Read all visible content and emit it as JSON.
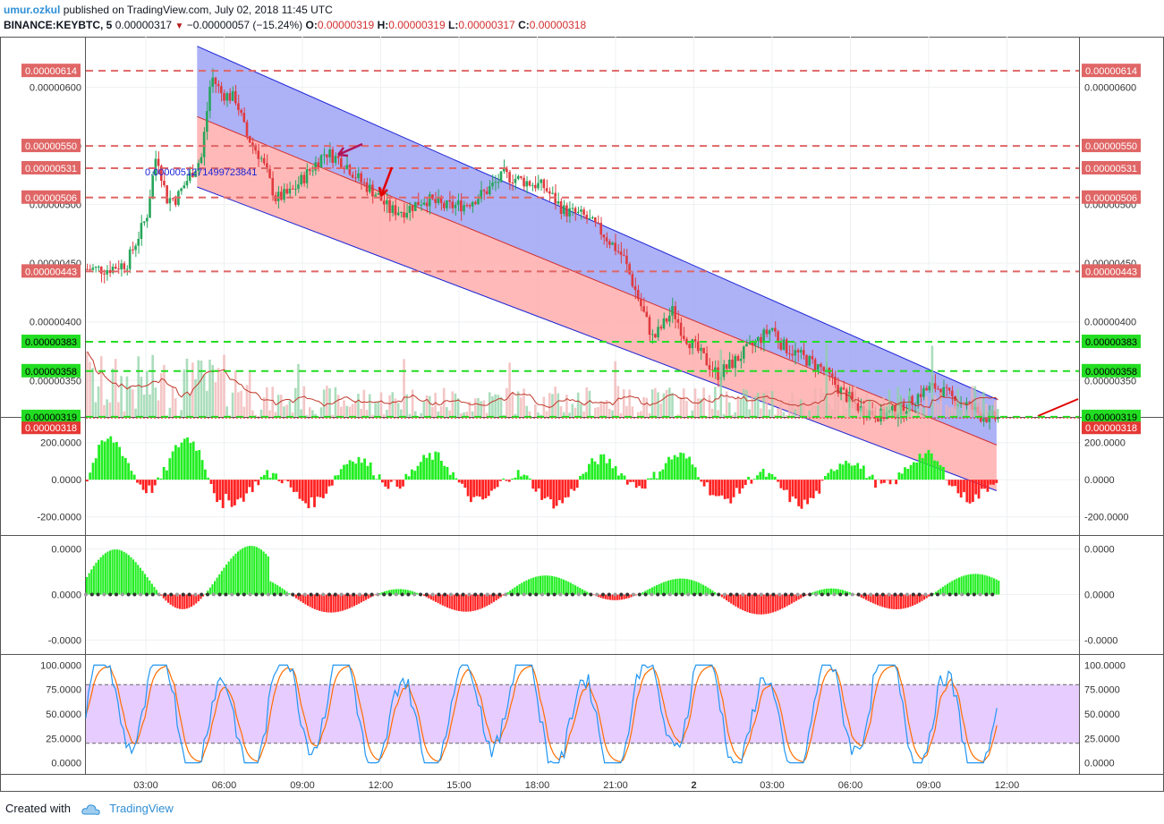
{
  "header": {
    "author": "umur.ozkul",
    "published": "published on TradingView.com, July 02, 2018 11:45 UTC",
    "symbol": "BINANCE:KEYBTC, 5",
    "last": "0.00000317",
    "change": "−0.00000057 (−15.24%)",
    "o_label": "O:",
    "o": "0.00000319",
    "h_label": "H:",
    "h": "0.00000319",
    "l_label": "L:",
    "l": "0.00000317",
    "c_label": "C:",
    "c": "0.00000318"
  },
  "footer": {
    "created_with": "Created with",
    "brand": "TradingView"
  },
  "colors": {
    "up": "#26a65b",
    "down": "#e03a3e",
    "red_level": "#e06666",
    "green_level": "#22dd22",
    "channel_upper": "#9fa3f5",
    "channel_lower": "#ffadad",
    "osc_up": "#22ee22",
    "osc_down": "#ff2222",
    "stoch_k": "#2196f3",
    "stoch_d": "#ff6d00",
    "stoch_band": "#e6ccff"
  },
  "chart_data": [
    {
      "type": "candlestick",
      "title": "",
      "x_ticks": [
        "03:00",
        "06:00",
        "09:00",
        "12:00",
        "15:00",
        "18:00",
        "21:00",
        "2",
        "03:00",
        "06:00",
        "09:00",
        "12:00"
      ],
      "y_ticks": [
        "0.00000600",
        "0.00000550",
        "0.00000500",
        "0.00000450",
        "0.00000400",
        "0.00000350"
      ],
      "ylim": [
        3.075e-06,
        6.355e-06
      ],
      "price_levels": [
        {
          "label": "0.00000614",
          "value": 6.14e-06,
          "color": "red"
        },
        {
          "label": "0.00000550",
          "value": 5.5e-06,
          "color": "red"
        },
        {
          "label": "0.00000531",
          "value": 5.31e-06,
          "color": "red"
        },
        {
          "label": "0.00000506",
          "value": 5.06e-06,
          "color": "red"
        },
        {
          "label": "0.00000443",
          "value": 4.43e-06,
          "color": "red"
        },
        {
          "label": "0.00000383",
          "value": 3.83e-06,
          "color": "green"
        },
        {
          "label": "0.00000358",
          "value": 3.58e-06,
          "color": "green"
        },
        {
          "label": "0.00000319",
          "value": 3.19e-06,
          "color": "green"
        }
      ],
      "last_price_label": "0.00000318",
      "annotation_text": "0.0000051271499723841",
      "close_path": [
        [
          0,
          4.45
        ],
        [
          0.02,
          4.45
        ],
        [
          0.04,
          4.5
        ],
        [
          0.06,
          4.9
        ],
        [
          0.07,
          5.45
        ],
        [
          0.08,
          5.05
        ],
        [
          0.09,
          5.05
        ],
        [
          0.1,
          5.2
        ],
        [
          0.115,
          5.4
        ],
        [
          0.125,
          6.1
        ],
        [
          0.135,
          5.95
        ],
        [
          0.15,
          5.9
        ],
        [
          0.16,
          5.6
        ],
        [
          0.175,
          5.4
        ],
        [
          0.19,
          5.05
        ],
        [
          0.205,
          5.1
        ],
        [
          0.22,
          5.25
        ],
        [
          0.24,
          5.45
        ],
        [
          0.26,
          5.35
        ],
        [
          0.275,
          5.2
        ],
        [
          0.29,
          5.1
        ],
        [
          0.305,
          4.95
        ],
        [
          0.32,
          4.95
        ],
        [
          0.34,
          5.05
        ],
        [
          0.36,
          4.98
        ],
        [
          0.38,
          5.0
        ],
        [
          0.4,
          5.1
        ],
        [
          0.42,
          5.25
        ],
        [
          0.44,
          5.2
        ],
        [
          0.46,
          5.15
        ],
        [
          0.48,
          4.95
        ],
        [
          0.5,
          4.9
        ],
        [
          0.52,
          4.75
        ],
        [
          0.54,
          4.55
        ],
        [
          0.555,
          4.2
        ],
        [
          0.57,
          3.85
        ],
        [
          0.59,
          4.1
        ],
        [
          0.6,
          3.9
        ],
        [
          0.62,
          3.7
        ],
        [
          0.635,
          3.55
        ],
        [
          0.65,
          3.65
        ],
        [
          0.67,
          3.8
        ],
        [
          0.69,
          3.95
        ],
        [
          0.7,
          3.8
        ],
        [
          0.72,
          3.7
        ],
        [
          0.74,
          3.6
        ],
        [
          0.76,
          3.4
        ],
        [
          0.78,
          3.25
        ],
        [
          0.8,
          3.2
        ],
        [
          0.82,
          3.25
        ],
        [
          0.84,
          3.4
        ],
        [
          0.855,
          3.45
        ],
        [
          0.87,
          3.35
        ],
        [
          0.885,
          3.3
        ],
        [
          0.9,
          3.2
        ],
        [
          0.91,
          3.18
        ]
      ],
      "volume_note": "volume histogram with moving average"
    },
    {
      "type": "bar",
      "title": "",
      "y_ticks": [
        "200.0000",
        "0.0000",
        "-200.0000"
      ],
      "ylim": [
        -260,
        300
      ],
      "series_note": "momentum oscillator histogram"
    },
    {
      "type": "bar",
      "title": "",
      "y_ticks": [
        "0.0000",
        "0.0000",
        "-0.0000"
      ],
      "ylim": [
        -1.15,
        1.15
      ],
      "series_note": "squeeze momentum histogram"
    },
    {
      "type": "line",
      "title": "",
      "y_ticks": [
        "100.0000",
        "75.0000",
        "50.0000",
        "25.0000",
        "0.0000"
      ],
      "ylim": [
        -4,
        104
      ],
      "band": [
        20,
        80
      ],
      "series_note": "stochastic %K and %D"
    }
  ]
}
